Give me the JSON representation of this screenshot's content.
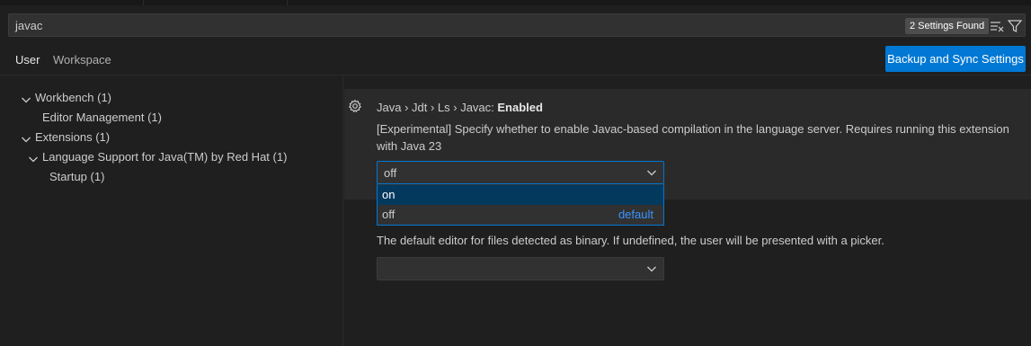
{
  "search": {
    "query": "javac",
    "results_badge": "2 Settings Found",
    "icons": [
      "clear-filter-icon",
      "filter-icon"
    ]
  },
  "tabs": [
    {
      "label": "User",
      "active": true
    },
    {
      "label": "Workspace",
      "active": false
    }
  ],
  "sync_button": "Backup and Sync Settings",
  "tree": [
    {
      "label": "Workbench (1)",
      "expanded": true
    },
    {
      "label": "Editor Management (1)"
    },
    {
      "label": "Extensions (1)",
      "expanded": true
    },
    {
      "label": "Language Support for Java(TM) by Red Hat (1)",
      "expanded": true
    },
    {
      "label": "Startup (1)"
    }
  ],
  "setting": {
    "breadcrumb": "Java › Jdt › Ls › Javac: ",
    "name": "Enabled",
    "description": "[Experimental] Specify whether to enable Javac-based compilation in the language server. Requires running this extension with Java 23",
    "value": "off",
    "options": [
      {
        "label": "on",
        "highlighted": true,
        "tag": ""
      },
      {
        "label": "off",
        "highlighted": false,
        "tag": "default"
      }
    ]
  },
  "setting2": {
    "description": "The default editor for files detected as binary. If undefined, the user will be presented with a picker.",
    "value": ""
  },
  "colors": {
    "accent": "#0078d4",
    "background": "#1f1f1f",
    "link": "#3794ff"
  }
}
